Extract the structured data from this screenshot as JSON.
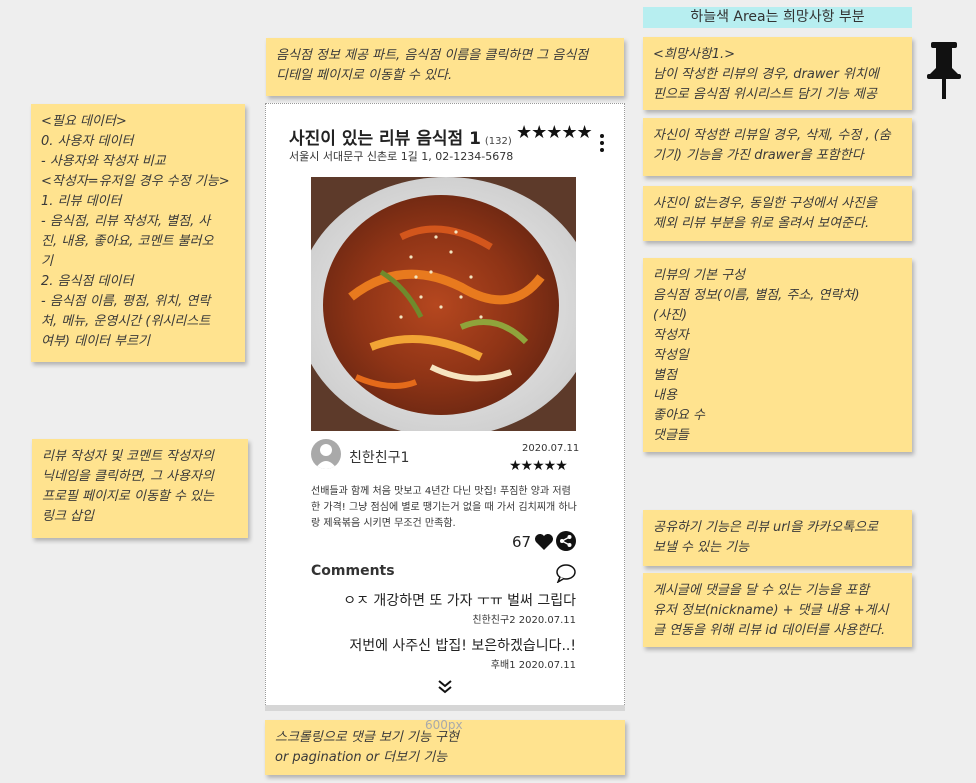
{
  "header": {
    "title": "하늘색 Area는 희망사항 부분"
  },
  "notes": {
    "top_center": "음식점 정보 제공 파트, 음식점 이름을 클릭하면 그 음식점\n디테일 페이지로 이동할 수 있다.",
    "left_data": "<필요 데이터>\n0. 사용자 데이터\n- 사용자와 작성자 비교\n<작성자=유저일 경우 수정 기능>\n1. 리뷰 데이터\n- 음식점, 리뷰 작성자, 별점, 사\n진, 내용, 좋아요, 코멘트 불러오\n기\n2. 음식점 데이터\n- 음식점 이름, 평점, 위치, 연락\n처, 메뉴, 운영시간 (위시리스트\n여부) 데이터 부르기",
    "left_link": "리뷰 작성자 및 코멘트 작성자의\n닉네임을 클릭하면, 그 사용자의\n프로필 페이지로 이동할 수 있는\n링크  삽입",
    "right_wish1": "<희망사항1.>\n남이 작성한 리뷰의 경우, drawer 위치에\n핀으로 음식점 위시리스트 담기 기능 제공",
    "right_drawer": "자신이 작성한 리뷰일 경우, 삭제, 수정 , (숨\n기기) 기능을  가진 drawer을 포함한다",
    "right_nophoto": "사진이 없는경우, 동일한 구성에서 사진을\n제외 리뷰 부분을 위로 올려서 보여준다.",
    "right_basic": "리뷰의 기본 구성\n음식점 정보(이름, 별점, 주소, 연락처)\n(사진)\n작성자\n작성일\n별점\n내용\n좋아요 수\n댓글들",
    "right_share": "공유하기 기능은 리뷰 url을 카카오톡으로\n보낼 수 있는 기능",
    "right_comment": "게시글에 댓글을 달 수 있는 기능을 포함\n유저 정보(nickname) + 댓글 내용 +게시\n글 연동을 위해 리뷰 id 데이터를 사용한다.",
    "bottom": "스크롤링으로 댓글 보기 기능 구현\nor pagination or 더보기 기능"
  },
  "width_label": "600px",
  "review": {
    "restaurant_name": "사진이 있는 리뷰 음식점 1",
    "review_count": "(132)",
    "rating_stars": "★★★★★",
    "address": "서울시 서대문구 신촌로 1길 1, 02-1234-5678",
    "author": "친한친구1",
    "date": "2020.07.11",
    "author_stars": "★★★★★",
    "content": "선배들과 함께 처음 맛보고 4년간 다닌 맛집! 푸짐한 양과 저렴한 가격! 그냥 점심에 별로 땡기는거 없을 때 가서 김치찌개 하나랑 제육볶음 시키면 무조건 만족함.",
    "likes": "67"
  },
  "comments": {
    "title": "Comments",
    "items": [
      {
        "text": "ㅇㅈ 개강하면 또 가자 ㅜㅠ 벌써 그립다",
        "meta": "친한친구2 2020.07.11"
      },
      {
        "text": "저번에 사주신 밥집! 보은하겠습니다..!",
        "meta": "후배1 2020.07.11"
      }
    ]
  },
  "icons": [
    "pushpin-icon",
    "kebab-menu-icon",
    "heart-icon",
    "share-icon",
    "comment-icon",
    "chevron-double-down-icon",
    "user-avatar-icon"
  ]
}
